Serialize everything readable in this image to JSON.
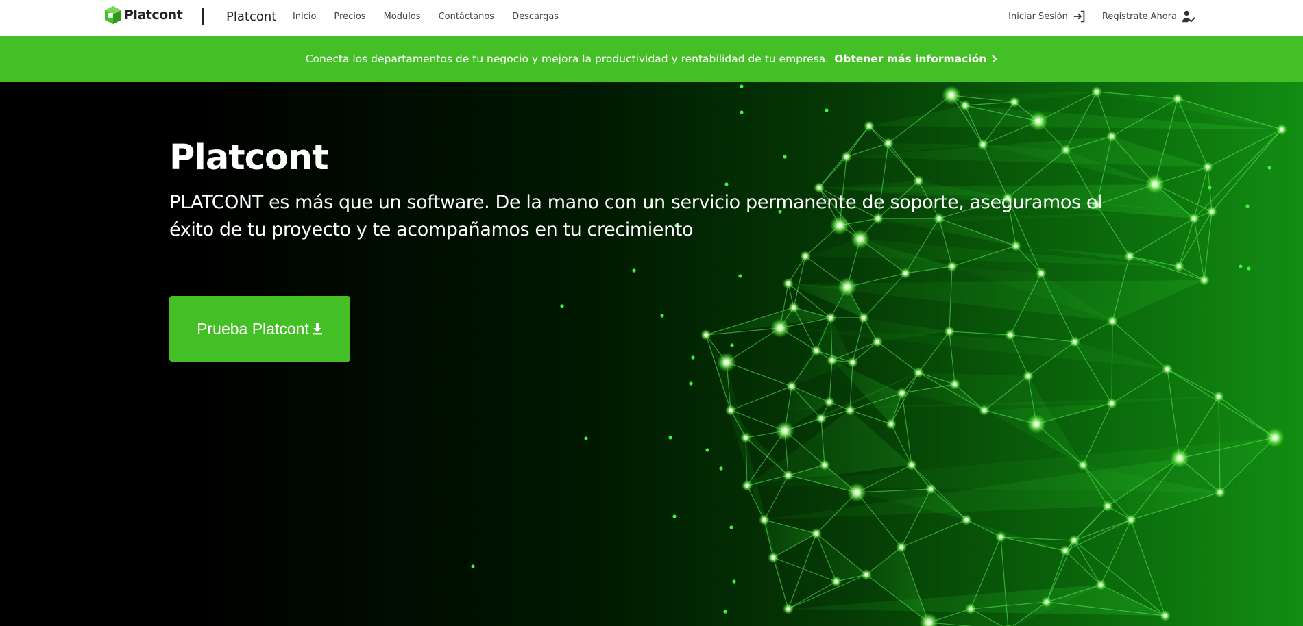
{
  "nav": {
    "brand": "Platcont",
    "title": "Platcont",
    "links": [
      "Inicio",
      "Precios",
      "Modulos",
      "Contáctanos",
      "Descargas"
    ],
    "login": "Iniciar Sesión",
    "register": "Registrate Ahora"
  },
  "promo": {
    "text": "Conecta los departamentos de tu negocio y mejora la productividad y rentabilidad de tu empresa.",
    "link": "Obtener más información"
  },
  "hero": {
    "title": "Platcont",
    "text": "PLATCONT es más que un software. De la mano con un servicio permanente de soporte, aseguramos el éxito de tu proyecto y te acompañamos en tu crecimiento",
    "cta": "Prueba Platcont"
  },
  "colors": {
    "brand_green": "#45bf26",
    "nav_bg": "#ffffff",
    "hero_bg": "#000000"
  },
  "icons": {
    "brand": "platcont-logo-icon",
    "login": "sign-in-icon",
    "register": "user-check-icon",
    "promo": "chevron-right-icon",
    "cta": "download-icon"
  }
}
